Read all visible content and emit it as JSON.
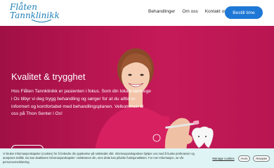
{
  "header": {
    "logo_line1": "Flåten",
    "logo_line2": "Tannklinikk",
    "nav": [
      "Behandlinger",
      "Om oss",
      "Kontakt oss"
    ],
    "cta_label": "Bestill time"
  },
  "hero": {
    "title": "Kvalitet & trygghet",
    "text": "Hos Flåten Tannklinikk er pasienten i fokus. Som din lokale tannlege i Os tilbyr vi deg trygg behandling og sørger for at du alltid er informert og komfortabel med behandlingsplanen. Velkommen til oss på Thon Senter i Os!"
  },
  "cookie": {
    "text": "Vi bruker informasjonskapsler (cookies) for å forbedre din opplevelse på nettstedet vårt. Informasjonskapslene hjelper oss med å huske preferanser og analysere trafikk. Du kan deaktivere informasjonskapsler i nettleseren din, men dette kan påvirke funksjonaliteten. For mer informasjon, se vår personvernerklæring.",
    "manage_label": "Manage cookies",
    "reject_label": "Avvis",
    "accept_label": "Aksepter"
  },
  "colors": {
    "brand_blue": "#1e78d6",
    "hero_pink": "#b81650",
    "banner_bg": "#dff5f5"
  }
}
